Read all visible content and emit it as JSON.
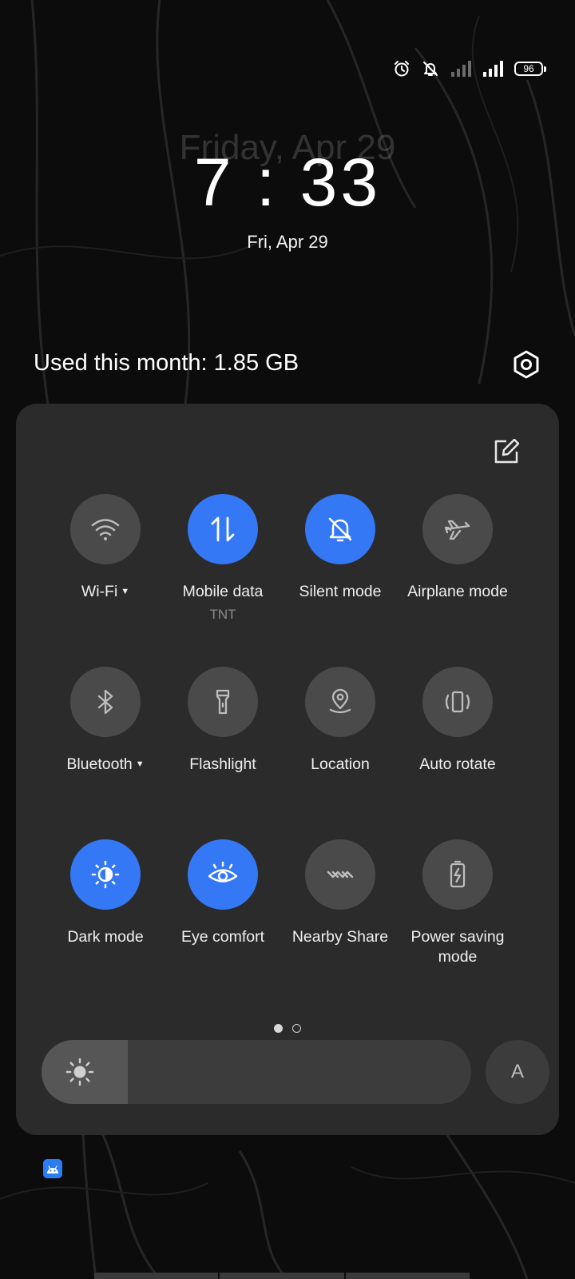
{
  "status_bar": {
    "icons": [
      "alarm-icon",
      "bell-off-icon",
      "signal-weak-icon",
      "signal-strong-icon"
    ],
    "battery_level": "96"
  },
  "lockscreen": {
    "ghost_date": "Friday, Apr 29",
    "clock": "7 : 33",
    "date": "Fri, Apr 29"
  },
  "header": {
    "usage_text": "Used this month: 1.85 GB",
    "settings_icon": "settings-hex-icon"
  },
  "panel": {
    "edit_icon": "edit-icon",
    "accent_color": "#3478f6",
    "tile_off_color": "#4a4a4a",
    "tiles": [
      {
        "label": "Wi-Fi",
        "sub": "",
        "on": false,
        "icon": "wifi-icon",
        "dropdown": true
      },
      {
        "label": "Mobile data",
        "sub": "TNT",
        "on": true,
        "icon": "mobile-data-icon",
        "dropdown": false
      },
      {
        "label": "Silent mode",
        "sub": "",
        "on": true,
        "icon": "bell-off-icon",
        "dropdown": false
      },
      {
        "label": "Airplane mode",
        "sub": "",
        "on": false,
        "icon": "airplane-icon",
        "dropdown": false
      },
      {
        "label": "Bluetooth",
        "sub": "",
        "on": false,
        "icon": "bluetooth-icon",
        "dropdown": true
      },
      {
        "label": "Flashlight",
        "sub": "",
        "on": false,
        "icon": "flashlight-icon",
        "dropdown": false
      },
      {
        "label": "Location",
        "sub": "",
        "on": false,
        "icon": "location-icon",
        "dropdown": false
      },
      {
        "label": "Auto rotate",
        "sub": "",
        "on": false,
        "icon": "auto-rotate-icon",
        "dropdown": false
      },
      {
        "label": "Dark mode",
        "sub": "",
        "on": true,
        "icon": "dark-mode-icon",
        "dropdown": false
      },
      {
        "label": "Eye comfort",
        "sub": "",
        "on": true,
        "icon": "eye-icon",
        "dropdown": false
      },
      {
        "label": "Nearby Share",
        "sub": "",
        "on": false,
        "icon": "nearby-share-icon",
        "dropdown": false
      },
      {
        "label": "Power saving mode",
        "sub": "",
        "on": false,
        "icon": "battery-saver-icon",
        "dropdown": false
      }
    ],
    "page_count": 2,
    "current_page": 1,
    "brightness_level": 0.2,
    "auto_brightness_label": "A"
  },
  "notification_icons": [
    "android-icon"
  ]
}
